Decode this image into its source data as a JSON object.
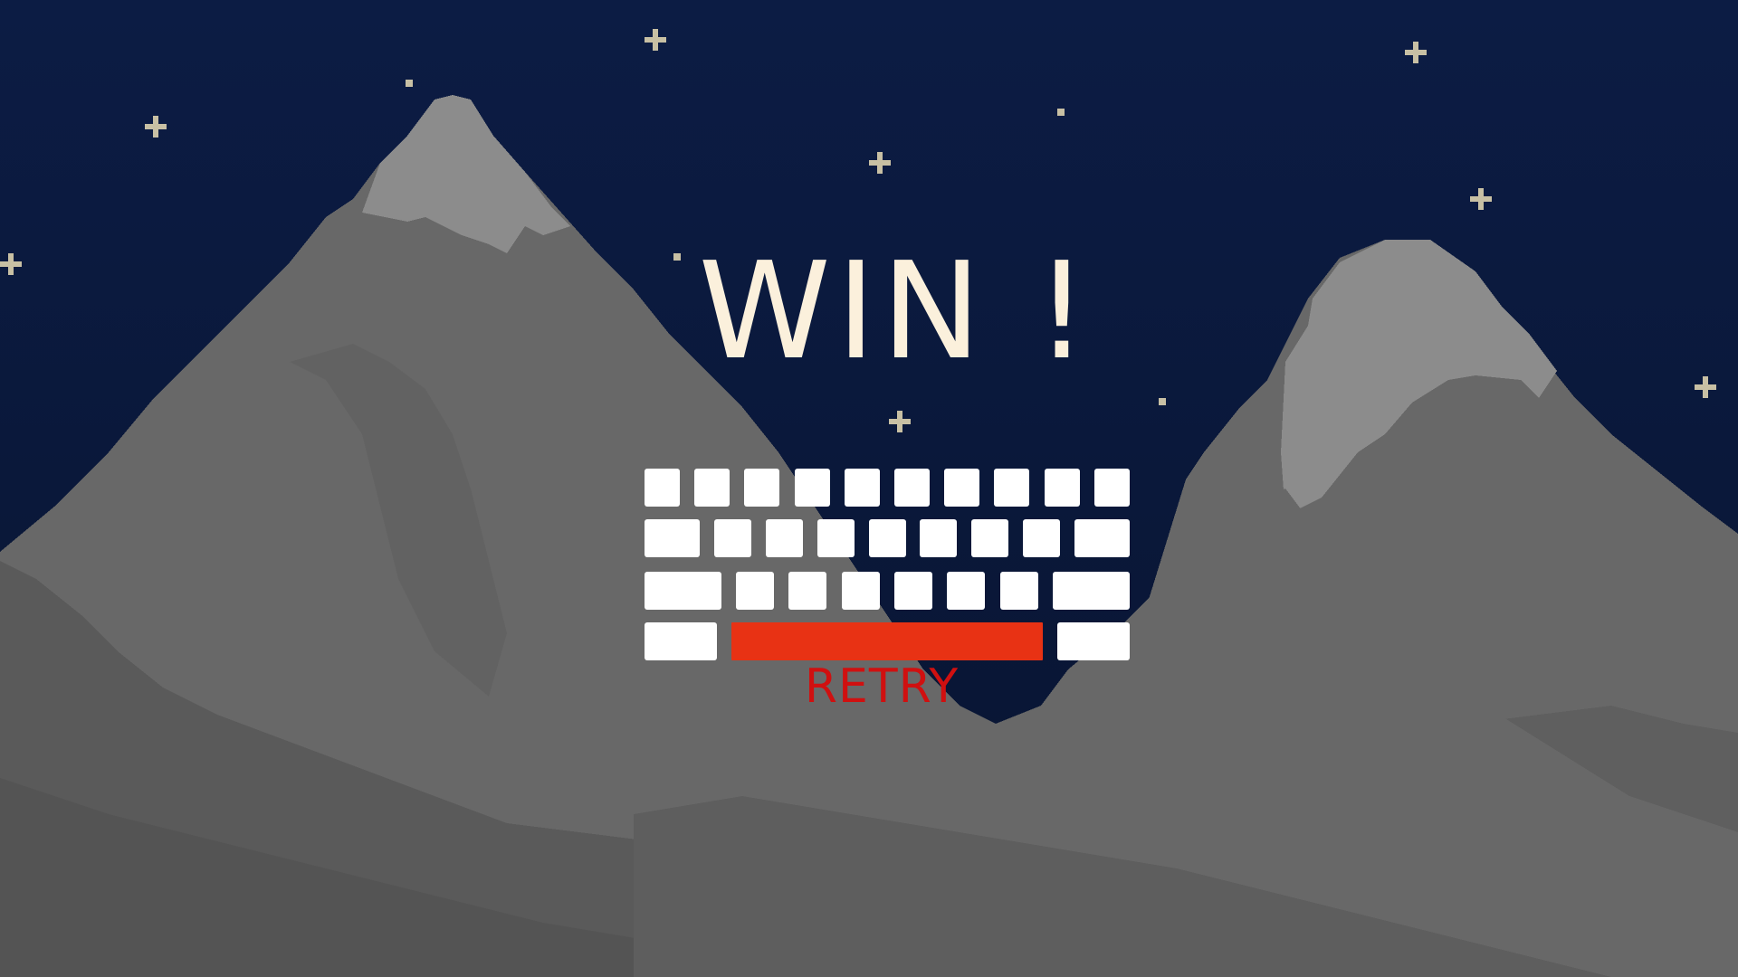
{
  "screen": {
    "title": "WIN !",
    "retry_label": "RETRY",
    "background_color": "#0b1a3f",
    "sky_gradient": [
      "#0b1a3f",
      "#0a1737"
    ],
    "mountain_colors": {
      "snow": "#8c8c8c",
      "body_light": "#6a6a6a",
      "body_mid": "#616161",
      "body_dark": "#555555"
    },
    "star_color": "#c8c0a4"
  },
  "keyboard": {
    "key_color": "#ffffff",
    "space_color": "#e83214",
    "rows": [
      [
        "key",
        "key",
        "key",
        "key",
        "key",
        "key",
        "key",
        "key",
        "key",
        "key"
      ],
      [
        "key-wide",
        "key",
        "key",
        "key",
        "key",
        "key",
        "key",
        "key",
        "key-wide"
      ],
      [
        "key-wider",
        "key",
        "key",
        "key",
        "key",
        "key",
        "key",
        "key-wider"
      ],
      [
        "key-wider",
        "space",
        "key-wider"
      ]
    ]
  }
}
